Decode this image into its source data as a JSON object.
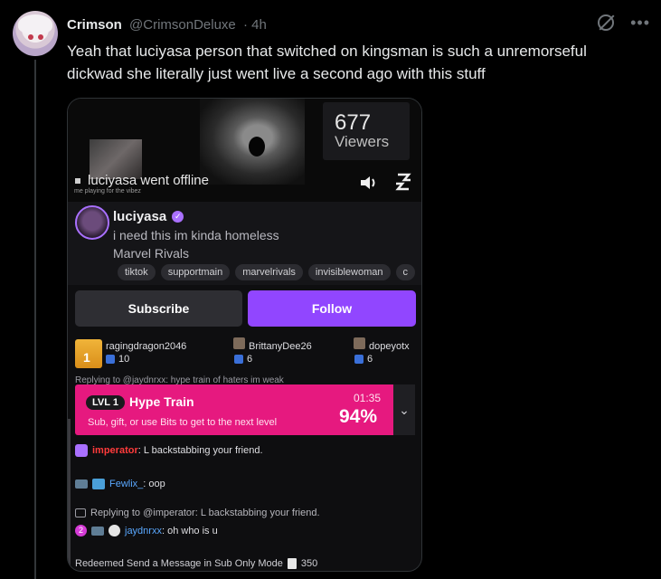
{
  "tweet": {
    "author_name": "Crimson",
    "handle": "@CrimsonDeluxe",
    "time": "· 4h",
    "text": "Yeah that luciyasa person that switched on kingsman is such a unremorseful dickwad she literally just went live a second ago with this stuff"
  },
  "media": {
    "viewers_count": "677",
    "viewers_label": "Viewers",
    "offline_text": "luciyasa went offline",
    "tiny_caption": "me playing for the vibez",
    "channel": {
      "name": "luciyasa",
      "title": "i need this im kinda homeless",
      "game": "Marvel Rivals",
      "tags": [
        "tiktok",
        "supportmain",
        "marvelrivals",
        "invisiblewoman",
        "c"
      ]
    },
    "subscribe_label": "Subscribe",
    "follow_label": "Follow",
    "gifters": [
      {
        "name": "ragingdragon2046",
        "count": "10"
      },
      {
        "name": "BrittanyDee26",
        "count": "6"
      },
      {
        "name": "dopeyotx",
        "count": "6"
      }
    ],
    "replying_top": "Replying to @jaydnrxx: hype train of haters im weak",
    "hype_train": {
      "level": "LVL 1",
      "title": "Hype Train",
      "subtitle": "Sub, gift, or use Bits to get to the next level",
      "time": "01:35",
      "percent": "94%",
      "progress": 0.94,
      "color": "#e6197f"
    },
    "chat": {
      "msg1_user": "imperator",
      "msg1_text": ": L backstabbing your friend.",
      "msg2_user": "Fewlix_",
      "msg2_text": ": oop",
      "reply_line": "Replying to @imperator: L backstabbing your friend.",
      "msg3_user": "jaydnrxx",
      "msg3_text": ": oh who is u",
      "badge_two": "2"
    },
    "redeem_text": "Redeemed Send a Message in Sub Only Mode",
    "redeem_cost": "350"
  },
  "colors": {
    "twitch_purple": "#9146ff",
    "hype_pink": "#e6197f"
  }
}
